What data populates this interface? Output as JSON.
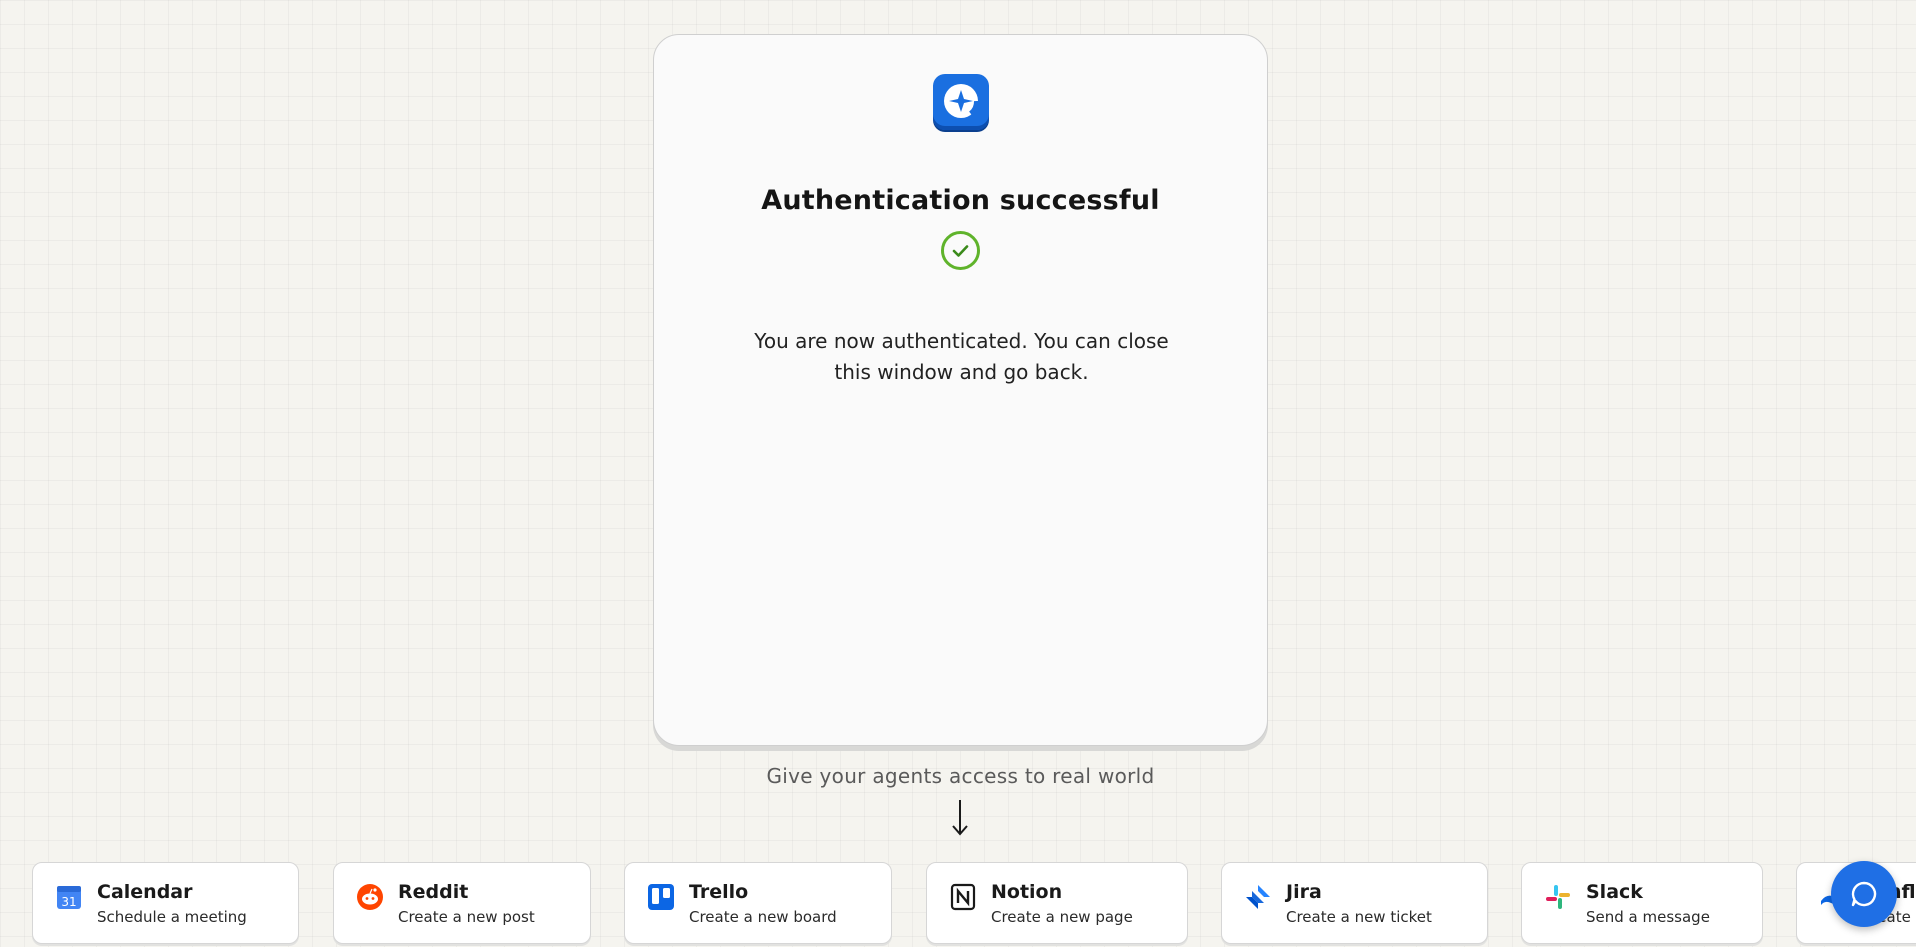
{
  "card": {
    "logo_icon": "sparkle-c-logo-icon",
    "title": "Authentication successful",
    "status_icon": "check-circle-icon",
    "message": "You are now authenticated. You can close this window and go back."
  },
  "tagline": "Give your agents access to real world",
  "arrow_icon": "arrow-down-icon",
  "apps": [
    {
      "name": "Calendar",
      "action": "Schedule a meeting",
      "icon": "calendar-icon"
    },
    {
      "name": "Reddit",
      "action": "Create a new post",
      "icon": "reddit-icon"
    },
    {
      "name": "Trello",
      "action": "Create a new board",
      "icon": "trello-icon"
    },
    {
      "name": "Notion",
      "action": "Create a new page",
      "icon": "notion-icon"
    },
    {
      "name": "Jira",
      "action": "Create a new ticket",
      "icon": "jira-icon"
    },
    {
      "name": "Slack",
      "action": "Send a message",
      "icon": "slack-icon"
    },
    {
      "name": "Confluence",
      "action": "Create a c",
      "icon": "confluence-icon"
    }
  ],
  "chat_icon": "chat-bubble-icon",
  "colors": {
    "brand": "#1a6fe0",
    "success": "#5fb32b",
    "background": "#f5f4ef"
  }
}
